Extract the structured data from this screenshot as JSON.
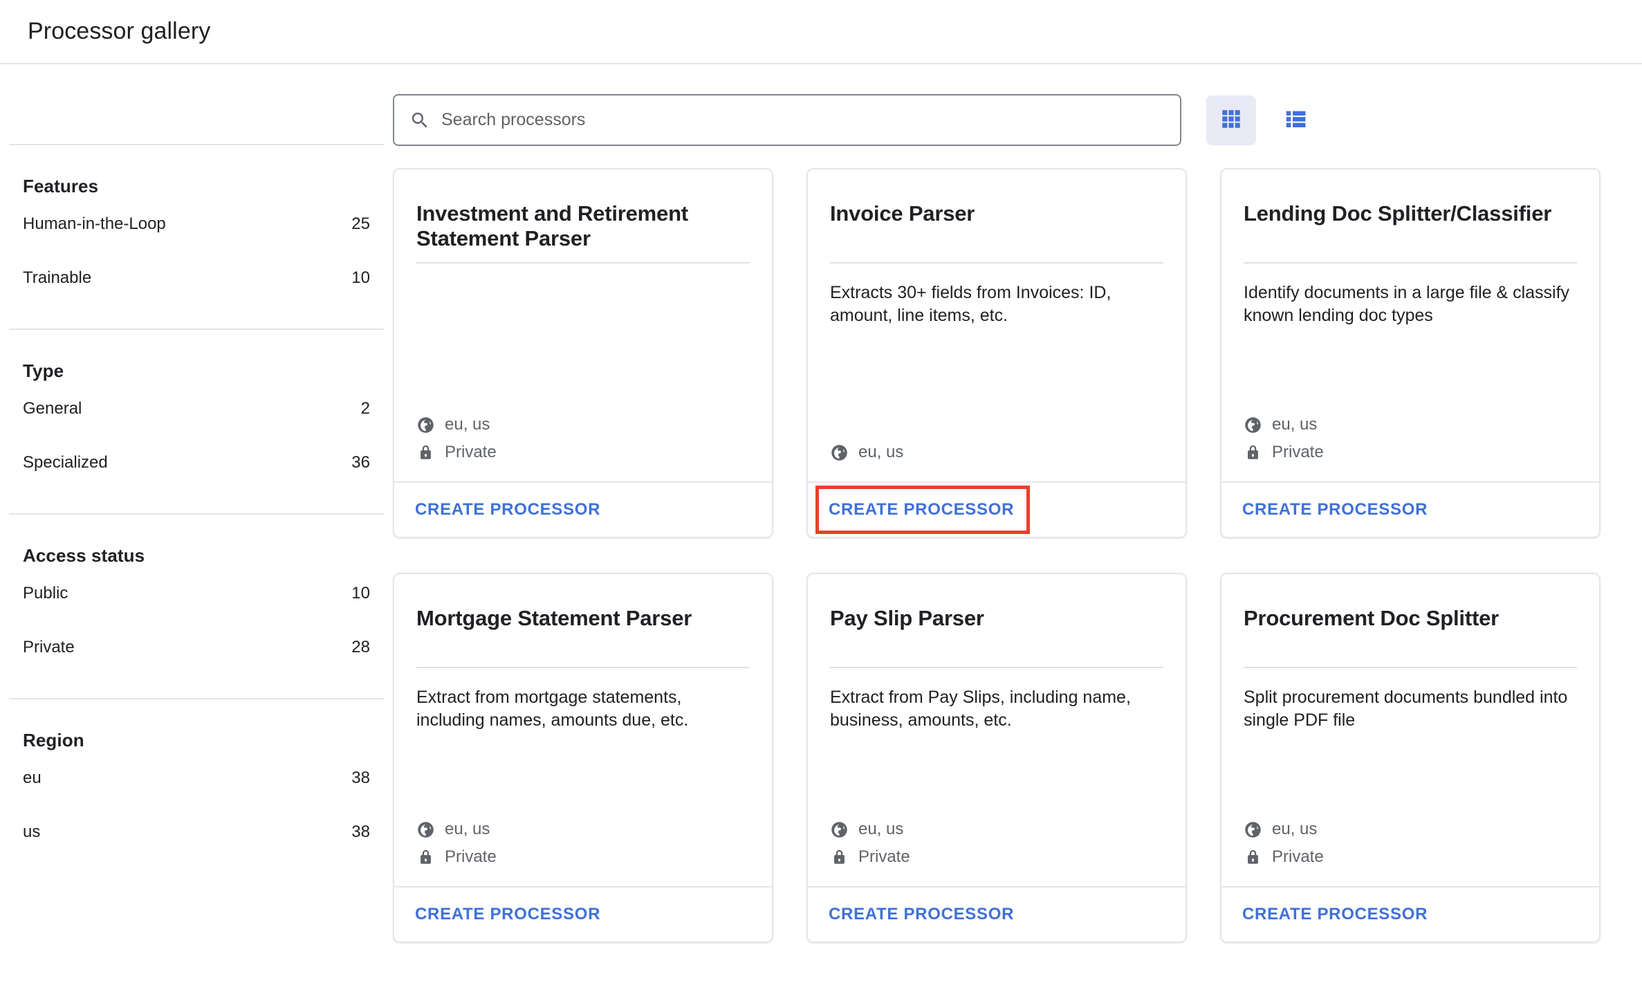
{
  "header": {
    "title": "Processor gallery"
  },
  "search": {
    "placeholder": "Search processors",
    "value": "",
    "icon": "search-icon"
  },
  "view_toggle": {
    "grid_icon": "grid-view-icon",
    "list_icon": "list-view-icon",
    "active": "grid"
  },
  "colors": {
    "link_blue": "#4070d8",
    "highlight_red": "#e8402a",
    "active_toggle_bg": "#e8eaf6",
    "divider": "#e4e5e7"
  },
  "sidebar": {
    "groups": [
      {
        "heading": "Features",
        "rows": [
          {
            "label": "Human-in-the-Loop",
            "count": "25"
          },
          {
            "label": "Trainable",
            "count": "10"
          }
        ]
      },
      {
        "heading": "Type",
        "rows": [
          {
            "label": "General",
            "count": "2"
          },
          {
            "label": "Specialized",
            "count": "36"
          }
        ]
      },
      {
        "heading": "Access status",
        "rows": [
          {
            "label": "Public",
            "count": "10"
          },
          {
            "label": "Private",
            "count": "28"
          }
        ]
      },
      {
        "heading": "Region",
        "rows": [
          {
            "label": "eu",
            "count": "38"
          },
          {
            "label": "us",
            "count": "38"
          }
        ]
      }
    ]
  },
  "cards": [
    {
      "title": "Investment and Retirement Statement Parser",
      "description": "",
      "region": "eu, us",
      "access": "Private",
      "action_label": "CREATE PROCESSOR",
      "highlighted": false
    },
    {
      "title": "Invoice Parser",
      "description": "Extracts 30+ fields from Invoices: ID, amount, line items, etc.",
      "region": "eu, us",
      "access": "",
      "action_label": "CREATE PROCESSOR",
      "highlighted": true
    },
    {
      "title": "Lending Doc Splitter/Classifier",
      "description": "Identify documents in a large file & classify known lending doc types",
      "region": "eu, us",
      "access": "Private",
      "action_label": "CREATE PROCESSOR",
      "highlighted": false
    },
    {
      "title": "Mortgage Statement Parser",
      "description": "Extract from mortgage statements, including names, amounts due, etc.",
      "region": "eu, us",
      "access": "Private",
      "action_label": "CREATE PROCESSOR",
      "highlighted": false
    },
    {
      "title": "Pay Slip Parser",
      "description": "Extract from Pay Slips, including name, business, amounts, etc.",
      "region": "eu, us",
      "access": "Private",
      "action_label": "CREATE PROCESSOR",
      "highlighted": false
    },
    {
      "title": "Procurement Doc Splitter",
      "description": "Split procurement documents bundled into single PDF file",
      "region": "eu, us",
      "access": "Private",
      "action_label": "CREATE PROCESSOR",
      "highlighted": false
    }
  ]
}
